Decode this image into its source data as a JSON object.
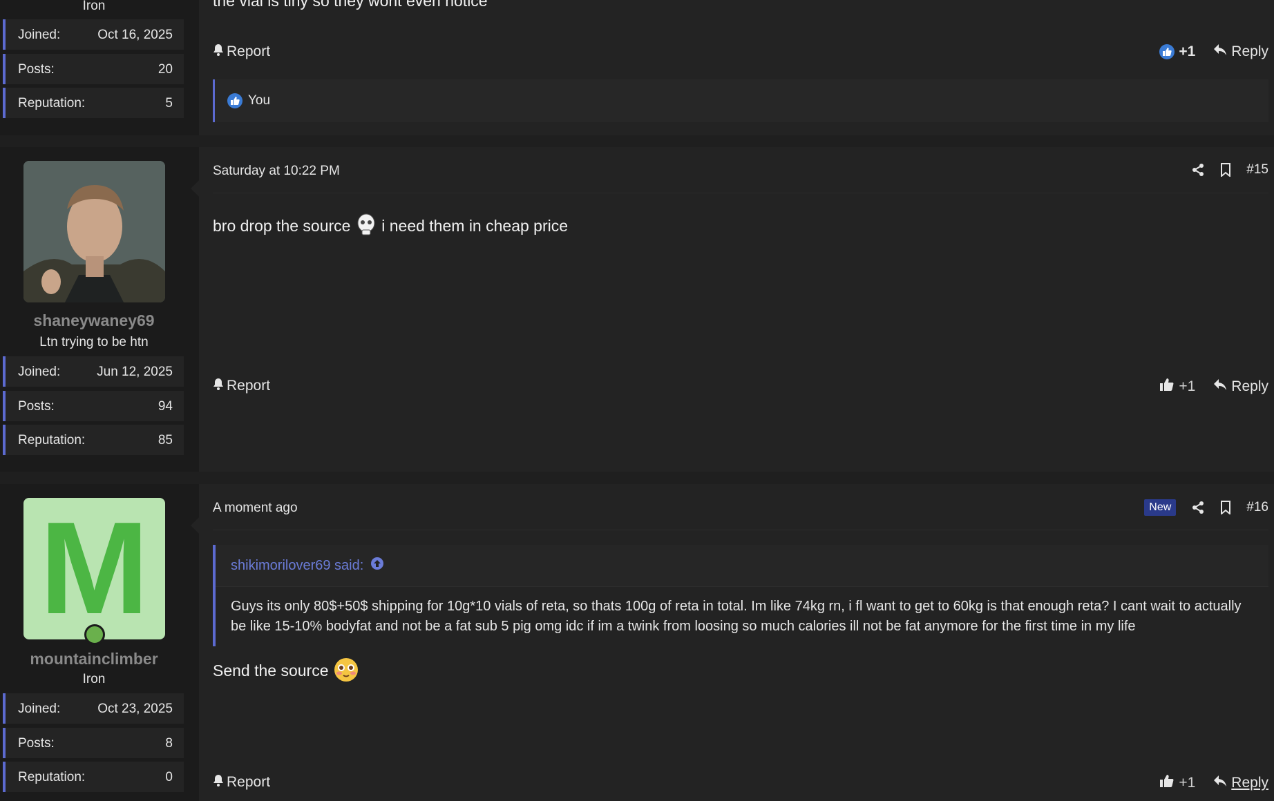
{
  "top_post": {
    "user_title": "Iron",
    "stats": [
      {
        "label": "Joined:",
        "value": "Oct 16, 2025"
      },
      {
        "label": "Posts:",
        "value": "20"
      },
      {
        "label": "Reputation:",
        "value": "5"
      }
    ],
    "body_text": "the vial is tiny so they wont even notice",
    "report_label": "Report",
    "like_count": "+1",
    "reply_label": "Reply",
    "reaction_user": "You"
  },
  "post15": {
    "username": "shaneywaney69",
    "user_title": "Ltn trying to be htn",
    "stats": [
      {
        "label": "Joined:",
        "value": "Jun 12, 2025"
      },
      {
        "label": "Posts:",
        "value": "94"
      },
      {
        "label": "Reputation:",
        "value": "85"
      }
    ],
    "date": "Saturday at 10:22 PM",
    "number": "#15",
    "body_before": "bro drop the source",
    "body_after": "i need them in cheap price",
    "report_label": "Report",
    "like_count": "+1",
    "reply_label": "Reply"
  },
  "post16": {
    "avatar_letter": "M",
    "username": "mountainclimber",
    "user_title": "Iron",
    "stats": [
      {
        "label": "Joined:",
        "value": "Oct 23, 2025"
      },
      {
        "label": "Posts:",
        "value": "8"
      },
      {
        "label": "Reputation:",
        "value": "0"
      }
    ],
    "date": "A moment ago",
    "new_badge": "New",
    "number": "#16",
    "quote_author": "shikimorilover69 said:",
    "quote_text": "Guys its only 80$+50$ shipping for 10g*10 vials of reta, so thats 100g of reta in total. Im like 74kg rn, i fl want to get to 60kg is that enough reta? I cant wait to actually be like 15-10% bodyfat and not be a fat sub 5 pig omg idc if im a twink from loosing so much calories ill not be fat anymore for the first time in my life",
    "body_text": "Send the source",
    "report_label": "Report",
    "like_count": "+1",
    "reply_label": "Reply"
  },
  "colors": {
    "accent": "#5c6ad0",
    "link": "#6b7cd8",
    "online": "#6ab04c",
    "avatar_bg": "#b9e4b1",
    "avatar_fg": "#4cb644"
  }
}
